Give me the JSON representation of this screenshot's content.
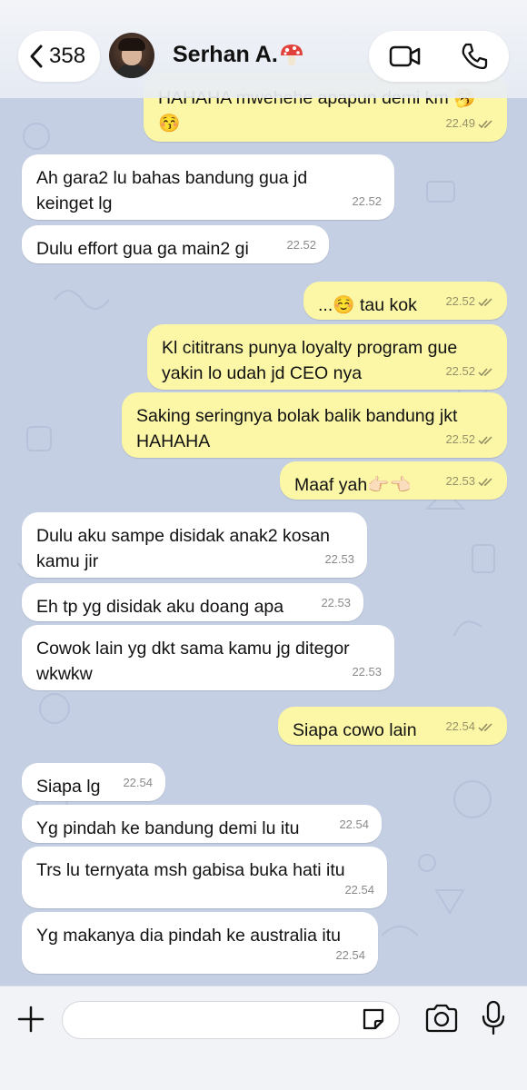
{
  "header": {
    "back_count": "358",
    "contact_name": "Serhan A.",
    "name_emoji": "mushroom-icon"
  },
  "messages": [
    {
      "dir": "out",
      "text": "HAHAHA mwehehe apapun demi km 🥱",
      "line2": "😚",
      "time": "22.49",
      "read": true
    },
    {
      "dir": "in",
      "text": "Ah gara2 lu bahas bandung gua jd",
      "line2": "keinget lg",
      "time": "22.52"
    },
    {
      "dir": "in",
      "text": "Dulu effort gua ga main2 gi",
      "time": "22.52"
    },
    {
      "dir": "out",
      "text": "...☺️ tau kok",
      "time": "22.52",
      "read": true
    },
    {
      "dir": "out",
      "text": "Kl cititrans punya loyalty program gue",
      "line2": "yakin lo udah jd CEO nya",
      "time": "22.52",
      "read": true
    },
    {
      "dir": "out",
      "text": "Saking seringnya bolak balik bandung jkt",
      "line2": "HAHAHA",
      "time": "22.52",
      "read": true
    },
    {
      "dir": "out",
      "text": "Maaf yah👉🏻👈🏻",
      "time": "22.53",
      "read": true
    },
    {
      "dir": "in",
      "text": "Dulu aku sampe disidak anak2 kosan",
      "line2": "kamu jir",
      "time": "22.53"
    },
    {
      "dir": "in",
      "text": "Eh tp yg disidak aku doang apa",
      "time": "22.53"
    },
    {
      "dir": "in",
      "text": "Cowok lain yg dkt sama kamu jg ditegor",
      "line2": "wkwkw",
      "time": "22.53"
    },
    {
      "dir": "out",
      "text": "Siapa cowo lain",
      "time": "22.54",
      "read": true
    },
    {
      "dir": "in",
      "text": "Siapa lg",
      "time": "22.54"
    },
    {
      "dir": "in",
      "text": "Yg pindah ke bandung demi lu itu",
      "time": "22.54"
    },
    {
      "dir": "in",
      "text": "Trs lu ternyata msh gabisa buka hati itu",
      "time": "22.54"
    },
    {
      "dir": "in",
      "text": "Yg makanya dia pindah ke australia itu",
      "time": "22.54"
    }
  ],
  "composer": {
    "placeholder": ""
  },
  "colors": {
    "incoming": "#ffffff",
    "outgoing": "#fbf7a6",
    "background": "#c4cfe4"
  }
}
